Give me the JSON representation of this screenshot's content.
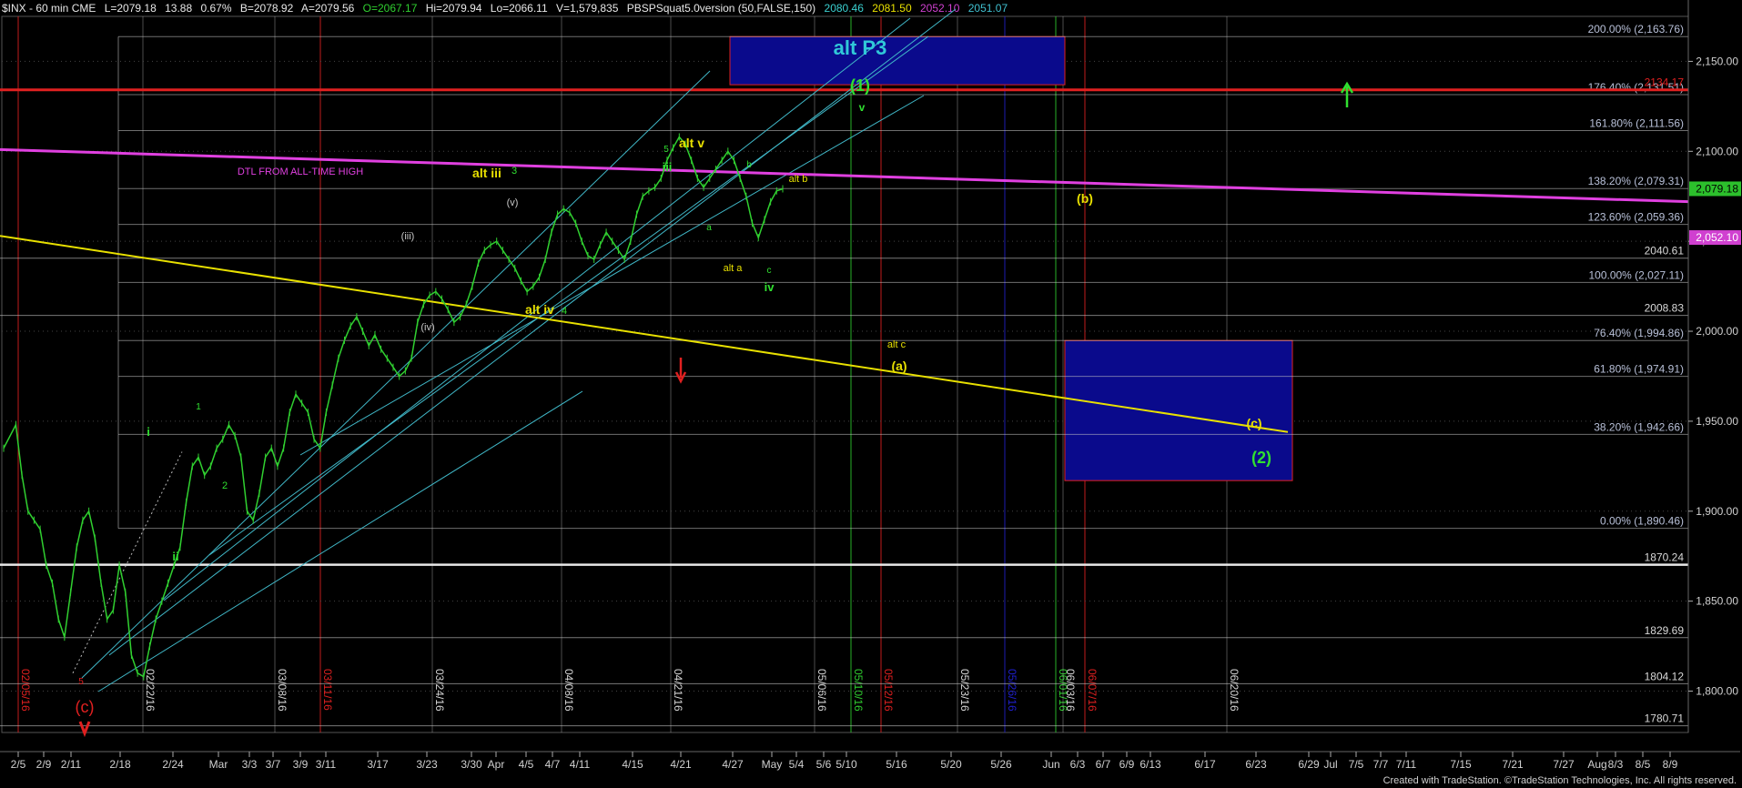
{
  "header": {
    "symbol": "$INX - 60 min  CME",
    "last": "L=2079.18",
    "change": "13.88",
    "change_pct": "0.67%",
    "bid": "B=2078.92",
    "ask": "A=2079.56",
    "open": "O=2067.17",
    "high": "Hi=2079.94",
    "low": "Lo=2066.11",
    "volume": "V=1,579,835",
    "indicator": "PBSPSquat5.0version (50,FALSE,150)",
    "ind_values": [
      {
        "text": "2080.46",
        "color": "#3ad0d0"
      },
      {
        "text": "2081.50",
        "color": "#e8e000"
      },
      {
        "text": "2052.10",
        "color": "#d040d0"
      },
      {
        "text": "2051.07",
        "color": "#40c0d0"
      }
    ]
  },
  "footer": "Created with TradeStation. ©TradeStation Technologies, Inc. All rights reserved.",
  "colors": {
    "background": "#000000",
    "fib_line": "#c8c8c8",
    "fib_label": "#b8c0d8",
    "price_line": "#30d030",
    "channel": "#40b8c8",
    "magenta": "#e040e0",
    "yellow": "#e8e000",
    "red": "#e02020",
    "green": "#30e030",
    "blue_box": "#0a0a8c",
    "box_border": "#e02020"
  },
  "chart_data": {
    "type": "line",
    "title": "$INX - 60 min",
    "ylim": [
      1777,
      2175
    ],
    "x_ticks": [
      "2/5",
      "2/9",
      "2/11",
      "2/18",
      "2/24",
      "Mar",
      "3/3",
      "3/7",
      "3/9",
      "3/11",
      "3/17",
      "3/23",
      "3/30",
      "Apr",
      "4/5",
      "4/7",
      "4/11",
      "4/15",
      "4/21",
      "4/27",
      "May",
      "5/4",
      "5/6",
      "5/10",
      "5/16",
      "5/20",
      "5/26",
      "Jun",
      "6/3",
      "6/7",
      "6/9",
      "6/13",
      "6/17",
      "6/23",
      "6/29",
      "Jul",
      "7/5",
      "7/7",
      "7/11",
      "7/15",
      "7/21",
      "7/27",
      "Aug",
      "8/3",
      "8/5",
      "8/9"
    ],
    "y_ticks": [
      "2,150.00",
      "2,100.00",
      "2,050.00",
      "2,000.00",
      "1,950.00",
      "1,900.00",
      "1,850.00",
      "1,800.00"
    ],
    "vertical_date_labels": [
      {
        "text": "02/05/16",
        "color": "#e02020"
      },
      {
        "text": "02/22/16",
        "color": "#d8d8d8"
      },
      {
        "text": "03/08/16",
        "color": "#d8d8d8"
      },
      {
        "text": "03/11/16",
        "color": "#e02020"
      },
      {
        "text": "03/24/16",
        "color": "#d8d8d8"
      },
      {
        "text": "04/08/16",
        "color": "#d8d8d8"
      },
      {
        "text": "04/21/16",
        "color": "#d8d8d8"
      },
      {
        "text": "05/06/16",
        "color": "#d8d8d8"
      },
      {
        "text": "05/10/16",
        "color": "#30d030"
      },
      {
        "text": "05/12/16",
        "color": "#e02020"
      },
      {
        "text": "05/23/16",
        "color": "#d8d8d8"
      },
      {
        "text": "05/26/16",
        "color": "#2020d0"
      },
      {
        "text": "06/01/16",
        "color": "#30d030"
      },
      {
        "text": "06/03/16",
        "color": "#d8d8d8"
      },
      {
        "text": "06/07/16",
        "color": "#e02020"
      },
      {
        "text": "06/20/16",
        "color": "#d8d8d8"
      }
    ],
    "fib_levels": [
      {
        "label": "200.00% (2,163.76)",
        "value": 2163.76
      },
      {
        "label": "176.40% (2,131.51)",
        "value": 2131.51
      },
      {
        "label": "161.80% (2,111.56)",
        "value": 2111.56
      },
      {
        "label": "138.20% (2,079.31)",
        "value": 2079.31
      },
      {
        "label": "123.60% (2,059.36)",
        "value": 2059.36
      },
      {
        "label": "100.00% (2,027.11)",
        "value": 2027.11
      },
      {
        "label": "76.40% (1,994.86)",
        "value": 1994.86
      },
      {
        "label": "61.80% (1,974.91)",
        "value": 1974.91
      },
      {
        "label": "38.20% (1,942.66)",
        "value": 1942.66
      },
      {
        "label": "0.00% (1,890.46)",
        "value": 1890.46
      }
    ],
    "horizontal_levels": [
      {
        "label": "2134.17",
        "value": 2134.17,
        "color": "#e02020"
      },
      {
        "label": "2040.61",
        "value": 2040.61,
        "color": "#c8c8c8"
      },
      {
        "label": "2008.83",
        "value": 2008.83,
        "color": "#c8c8c8"
      },
      {
        "label": "1870.24",
        "value": 1870.24,
        "color": "#e8e8e8"
      },
      {
        "label": "1829.69",
        "value": 1829.69,
        "color": "#c8c8c8"
      },
      {
        "label": "1804.12",
        "value": 1804.12,
        "color": "#c8c8c8"
      },
      {
        "label": "1780.71",
        "value": 1780.71,
        "color": "#c8c8c8"
      }
    ],
    "last_price": {
      "label": "2,079.18",
      "value": 2079.18
    },
    "marker_price": {
      "label": "2,052.10",
      "value": 2052.1
    },
    "price_series": [
      [
        0,
        1935
      ],
      [
        2,
        1948
      ],
      [
        3,
        1920
      ],
      [
        4,
        1900
      ],
      [
        5,
        1895
      ],
      [
        6,
        1890
      ],
      [
        7,
        1870
      ],
      [
        8,
        1860
      ],
      [
        9,
        1840
      ],
      [
        10,
        1830
      ],
      [
        11,
        1855
      ],
      [
        12,
        1880
      ],
      [
        13,
        1895
      ],
      [
        14,
        1900
      ],
      [
        15,
        1885
      ],
      [
        16,
        1860
      ],
      [
        17,
        1840
      ],
      [
        18,
        1845
      ],
      [
        19,
        1870
      ],
      [
        20,
        1855
      ],
      [
        21,
        1820
      ],
      [
        22,
        1810
      ],
      [
        23,
        1808
      ],
      [
        24,
        1825
      ],
      [
        25,
        1840
      ],
      [
        26,
        1850
      ],
      [
        27,
        1860
      ],
      [
        28,
        1870
      ],
      [
        29,
        1880
      ],
      [
        30,
        1905
      ],
      [
        31,
        1925
      ],
      [
        32,
        1930
      ],
      [
        33,
        1920
      ],
      [
        34,
        1925
      ],
      [
        35,
        1935
      ],
      [
        36,
        1940
      ],
      [
        37,
        1948
      ],
      [
        38,
        1942
      ],
      [
        39,
        1930
      ],
      [
        40,
        1900
      ],
      [
        41,
        1895
      ],
      [
        42,
        1910
      ],
      [
        43,
        1930
      ],
      [
        44,
        1935
      ],
      [
        45,
        1925
      ],
      [
        46,
        1935
      ],
      [
        47,
        1955
      ],
      [
        48,
        1965
      ],
      [
        49,
        1960
      ],
      [
        50,
        1955
      ],
      [
        51,
        1940
      ],
      [
        52,
        1935
      ],
      [
        53,
        1955
      ],
      [
        54,
        1970
      ],
      [
        55,
        1985
      ],
      [
        56,
        1995
      ],
      [
        57,
        2003
      ],
      [
        58,
        2008
      ],
      [
        59,
        2000
      ],
      [
        60,
        1992
      ],
      [
        61,
        1998
      ],
      [
        62,
        1990
      ],
      [
        63,
        1985
      ],
      [
        64,
        1980
      ],
      [
        65,
        1975
      ],
      [
        66,
        1978
      ],
      [
        67,
        1985
      ],
      [
        68,
        2005
      ],
      [
        69,
        2015
      ],
      [
        70,
        2020
      ],
      [
        71,
        2022
      ],
      [
        72,
        2018
      ],
      [
        73,
        2012
      ],
      [
        74,
        2005
      ],
      [
        75,
        2008
      ],
      [
        76,
        2015
      ],
      [
        77,
        2025
      ],
      [
        78,
        2038
      ],
      [
        79,
        2045
      ],
      [
        80,
        2048
      ],
      [
        81,
        2050
      ],
      [
        82,
        2045
      ],
      [
        83,
        2040
      ],
      [
        84,
        2035
      ],
      [
        85,
        2028
      ],
      [
        86,
        2022
      ],
      [
        87,
        2025
      ],
      [
        88,
        2030
      ],
      [
        89,
        2040
      ],
      [
        90,
        2055
      ],
      [
        91,
        2065
      ],
      [
        92,
        2068
      ],
      [
        93,
        2066
      ],
      [
        94,
        2060
      ],
      [
        95,
        2050
      ],
      [
        96,
        2042
      ],
      [
        97,
        2040
      ],
      [
        98,
        2048
      ],
      [
        99,
        2055
      ],
      [
        100,
        2050
      ],
      [
        101,
        2045
      ],
      [
        102,
        2040
      ],
      [
        103,
        2050
      ],
      [
        104,
        2065
      ],
      [
        105,
        2075
      ],
      [
        106,
        2078
      ],
      [
        107,
        2080
      ],
      [
        108,
        2085
      ],
      [
        109,
        2095
      ],
      [
        110,
        2102
      ],
      [
        111,
        2108
      ],
      [
        112,
        2104
      ],
      [
        113,
        2095
      ],
      [
        114,
        2085
      ],
      [
        115,
        2080
      ],
      [
        116,
        2085
      ],
      [
        117,
        2090
      ],
      [
        118,
        2095
      ],
      [
        119,
        2100
      ],
      [
        120,
        2095
      ],
      [
        121,
        2085
      ],
      [
        122,
        2075
      ],
      [
        123,
        2060
      ],
      [
        124,
        2052
      ],
      [
        125,
        2062
      ],
      [
        126,
        2072
      ],
      [
        127,
        2078
      ],
      [
        128,
        2079.18
      ]
    ],
    "x_series_range": [
      0,
      200
    ],
    "annotations": [
      {
        "text": "alt  P3",
        "color": "#30c8d8",
        "size": 22,
        "bold": true
      },
      {
        "text": "(1)",
        "color": "#30e030",
        "size": 18,
        "bold": true
      },
      {
        "text": "v",
        "color": "#30e030",
        "size": 12,
        "bold": true
      },
      {
        "text": "DTL FROM ALL-TIME HIGH",
        "color": "#e040e0",
        "size": 11,
        "bold": false
      },
      {
        "text": "alt iii",
        "color": "#e8e000",
        "size": 14,
        "bold": true
      },
      {
        "text": "3",
        "color": "#30e030",
        "size": 11,
        "bold": false
      },
      {
        "text": "iii",
        "color": "#30e030",
        "size": 13,
        "bold": true
      },
      {
        "text": "5",
        "color": "#30e030",
        "size": 10,
        "bold": false
      },
      {
        "text": "alt v",
        "color": "#e8e000",
        "size": 14,
        "bold": true
      },
      {
        "text": "b",
        "color": "#30e030",
        "size": 10,
        "bold": false
      },
      {
        "text": "alt b",
        "color": "#e8e000",
        "size": 11,
        "bold": false
      },
      {
        "text": "a",
        "color": "#30e030",
        "size": 10,
        "bold": false
      },
      {
        "text": "alt a",
        "color": "#e8e000",
        "size": 11,
        "bold": false
      },
      {
        "text": "c",
        "color": "#30e030",
        "size": 10,
        "bold": false
      },
      {
        "text": "iv",
        "color": "#30e030",
        "size": 13,
        "bold": true
      },
      {
        "text": "(v)",
        "color": "#c8c8c8",
        "size": 11,
        "bold": false
      },
      {
        "text": "(iii)",
        "color": "#c8c8c8",
        "size": 11,
        "bold": false
      },
      {
        "text": "(iv)",
        "color": "#c8c8c8",
        "size": 11,
        "bold": false
      },
      {
        "text": "alt iv",
        "color": "#e8e000",
        "size": 14,
        "bold": true
      },
      {
        "text": "4",
        "color": "#30e030",
        "size": 11,
        "bold": false
      },
      {
        "text": "alt c",
        "color": "#e8e000",
        "size": 11,
        "bold": false
      },
      {
        "text": "(a)",
        "color": "#e8e000",
        "size": 14,
        "bold": true
      },
      {
        "text": "(b)",
        "color": "#e8e000",
        "size": 14,
        "bold": true
      },
      {
        "text": "(c)",
        "color": "#e8e000",
        "size": 14,
        "bold": true
      },
      {
        "text": "(2)",
        "color": "#30e030",
        "size": 18,
        "bold": true
      },
      {
        "text": "i",
        "color": "#30e030",
        "size": 13,
        "bold": true
      },
      {
        "text": "ii",
        "color": "#30e030",
        "size": 13,
        "bold": true
      },
      {
        "text": "1",
        "color": "#30e030",
        "size": 10,
        "bold": false
      },
      {
        "text": "2",
        "color": "#30e030",
        "size": 11,
        "bold": false
      },
      {
        "text": "5",
        "color": "#e02020",
        "size": 10,
        "bold": false
      },
      {
        "text": "(c)",
        "color": "#e02020",
        "size": 18,
        "bold": false
      }
    ]
  }
}
